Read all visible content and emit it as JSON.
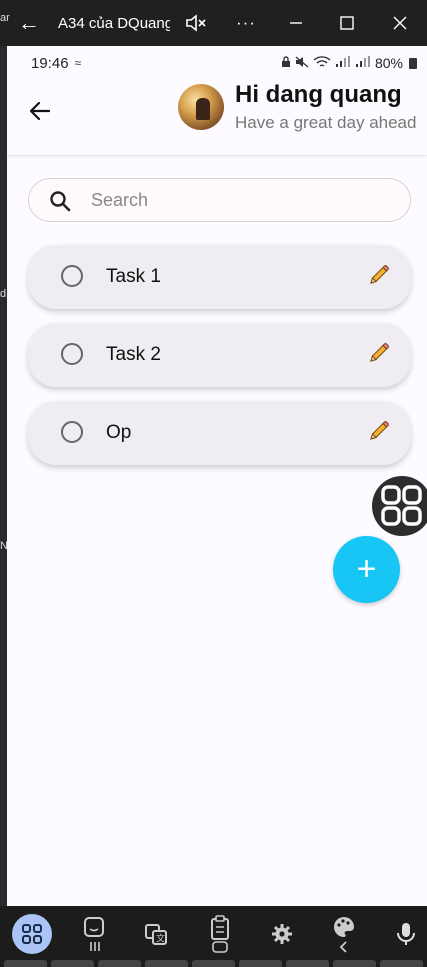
{
  "window": {
    "title": "A34 của DQuang",
    "back_icon": "←",
    "mute_icon": "🔇×",
    "more_icon": "···",
    "minimize_icon": "—",
    "maximize_icon": "☐",
    "close_icon": "✕"
  },
  "left_strip": [
    "ar",
    "d",
    "N"
  ],
  "status_bar": {
    "time": "19:46",
    "battery": "80%"
  },
  "header": {
    "greeting": "Hi dang quang",
    "subtitle": "Have a great day ahead"
  },
  "search": {
    "placeholder": "Search",
    "value": ""
  },
  "tasks": [
    {
      "label": "Task 1",
      "done": false
    },
    {
      "label": "Task 2",
      "done": false
    },
    {
      "label": "Op",
      "done": false
    }
  ],
  "add_button_label": "+",
  "taskbar_icons": [
    "apps-icon",
    "sticker-icon",
    "translate-icon",
    "clipboard-icon",
    "settings-icon",
    "palette-icon",
    "microphone-icon"
  ],
  "colors": {
    "accent_fab": "#17c6f5",
    "apps_button": "#a9c4f5",
    "card_bg": "#efedf1"
  }
}
